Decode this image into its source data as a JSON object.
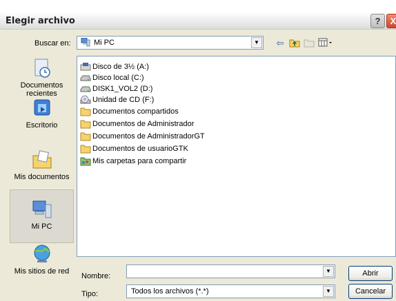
{
  "window": {
    "title": "Elegir archivo"
  },
  "titlebar": {
    "help": "?",
    "close": "X"
  },
  "lookin": {
    "label": "Buscar en:",
    "value": "Mi PC"
  },
  "places": [
    {
      "label": "Documentos recientes"
    },
    {
      "label": "Escritorio"
    },
    {
      "label": "Mis documentos"
    },
    {
      "label": "Mi PC"
    },
    {
      "label": "Mis sitios de red"
    }
  ],
  "files": [
    {
      "name": "Disco de 3½ (A:)",
      "icon": "floppy-drive-icon"
    },
    {
      "name": "Disco local (C:)",
      "icon": "hard-drive-icon"
    },
    {
      "name": "DISK1_VOL2 (D:)",
      "icon": "hard-drive-icon"
    },
    {
      "name": "Unidad de CD (F:)",
      "icon": "cd-drive-icon"
    },
    {
      "name": "Documentos compartidos",
      "icon": "folder-icon"
    },
    {
      "name": "Documentos de Administrador",
      "icon": "folder-icon"
    },
    {
      "name": "Documentos de AdministradorGT",
      "icon": "folder-icon"
    },
    {
      "name": "Documentos de usuarioGTK",
      "icon": "folder-icon"
    },
    {
      "name": "Mis carpetas para compartir",
      "icon": "shared-folder-icon"
    }
  ],
  "filename": {
    "label": "Nombre:",
    "value": ""
  },
  "filetype": {
    "label": "Tipo:",
    "value": "Todos los archivos (*.*)"
  },
  "buttons": {
    "open": "Abrir",
    "cancel": "Cancelar"
  }
}
